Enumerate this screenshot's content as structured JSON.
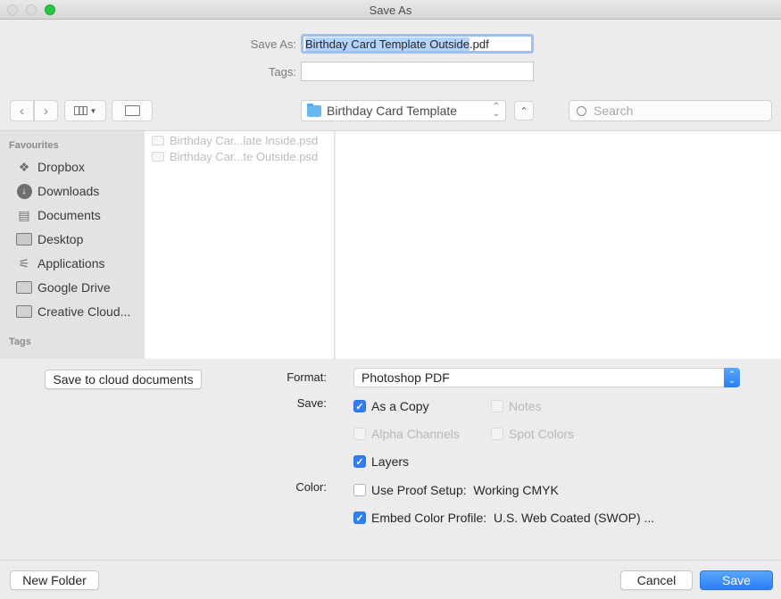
{
  "window": {
    "title": "Save As"
  },
  "save_as": {
    "label": "Save As:",
    "value_selected": "Birthday Card Template Outside",
    "value_extension": ".pdf"
  },
  "tags": {
    "label": "Tags:",
    "value": ""
  },
  "toolbar": {
    "back_icon": "chevron-left-icon",
    "forward_icon": "chevron-right-icon",
    "view_icon": "column-view-icon",
    "new_folder_icon": "folder-icon",
    "location": "Birthday Card Template",
    "search_placeholder": "Search"
  },
  "sidebar": {
    "favourites_header": "Favourites",
    "items": [
      {
        "label": "Dropbox",
        "icon": "dropbox-icon"
      },
      {
        "label": "Downloads",
        "icon": "downloads-icon"
      },
      {
        "label": "Documents",
        "icon": "documents-icon"
      },
      {
        "label": "Desktop",
        "icon": "desktop-icon"
      },
      {
        "label": "Applications",
        "icon": "applications-icon"
      },
      {
        "label": "Google Drive",
        "icon": "folder-icon"
      },
      {
        "label": "Creative Cloud...",
        "icon": "folder-icon"
      }
    ],
    "tags_header": "Tags"
  },
  "files": [
    {
      "name": "Birthday Car...late Inside.psd"
    },
    {
      "name": "Birthday Car...te Outside.psd"
    }
  ],
  "options": {
    "cloud_button": "Save to cloud documents",
    "format_label": "Format:",
    "format_value": "Photoshop PDF",
    "save_label": "Save:",
    "color_label": "Color:",
    "checkboxes": {
      "as_a_copy": {
        "label": "As a Copy",
        "checked": true,
        "enabled": true
      },
      "notes": {
        "label": "Notes",
        "checked": false,
        "enabled": false
      },
      "alpha_channels": {
        "label": "Alpha Channels",
        "checked": false,
        "enabled": false
      },
      "spot_colors": {
        "label": "Spot Colors",
        "checked": false,
        "enabled": false
      },
      "layers": {
        "label": "Layers",
        "checked": true,
        "enabled": true
      },
      "use_proof_setup": {
        "label": "Use Proof Setup:  Working CMYK",
        "checked": false,
        "enabled": true
      },
      "embed_color_profile": {
        "label": "Embed Color Profile:  U.S. Web Coated (SWOP) ...",
        "checked": true,
        "enabled": true
      }
    }
  },
  "footer": {
    "new_folder": "New Folder",
    "cancel": "Cancel",
    "save": "Save"
  },
  "colors": {
    "accent": "#2f7ef3",
    "traffic_maximize": "#28c840",
    "selection": "#b3d4fc"
  }
}
